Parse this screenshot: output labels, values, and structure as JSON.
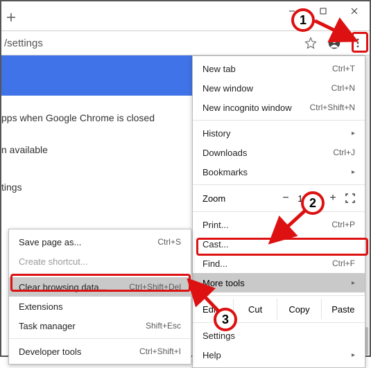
{
  "window": {
    "url": "/settings"
  },
  "page": {
    "line1": "pps when Google Chrome is closed",
    "line2": "n available",
    "line3": "tings"
  },
  "menu": {
    "new_tab": "New tab",
    "new_tab_sc": "Ctrl+T",
    "new_window": "New window",
    "new_window_sc": "Ctrl+N",
    "new_incognito": "New incognito window",
    "new_incognito_sc": "Ctrl+Shift+N",
    "history": "History",
    "downloads": "Downloads",
    "downloads_sc": "Ctrl+J",
    "bookmarks": "Bookmarks",
    "zoom_label": "Zoom",
    "zoom_minus": "−",
    "zoom_val": "100%",
    "zoom_plus": "+",
    "print": "Print...",
    "print_sc": "Ctrl+P",
    "cast": "Cast...",
    "find": "Find...",
    "find_sc": "Ctrl+F",
    "more_tools": "More tools",
    "edit": "Edit",
    "cut": "Cut",
    "copy": "Copy",
    "paste": "Paste",
    "settings": "Settings",
    "help": "Help"
  },
  "submenu": {
    "save_page": "Save page as...",
    "save_page_sc": "Ctrl+S",
    "create_shortcut": "Create shortcut...",
    "clear_browsing": "Clear browsing data...",
    "clear_browsing_sc": "Ctrl+Shift+Del",
    "extensions": "Extensions",
    "task_manager": "Task manager",
    "task_manager_sc": "Shift+Esc",
    "developer_tools": "Developer tools",
    "developer_tools_sc": "Ctrl+Shift+I"
  },
  "annotations": {
    "n1": "1",
    "n2": "2",
    "n3": "3"
  }
}
